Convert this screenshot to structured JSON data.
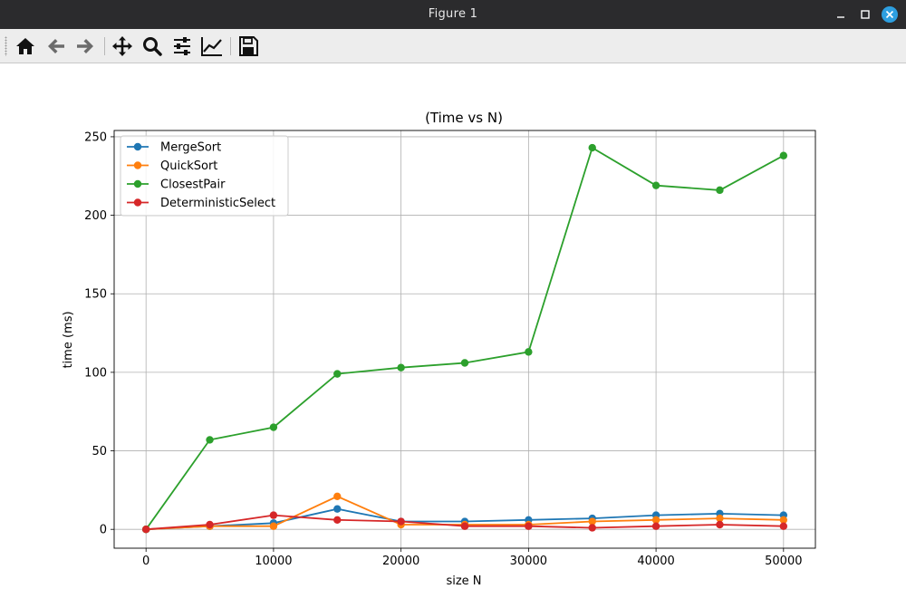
{
  "window": {
    "title": "Figure 1"
  },
  "toolbar": {
    "buttons": [
      {
        "name": "home-button",
        "icon": "home-icon"
      },
      {
        "name": "back-button",
        "icon": "arrow-left-icon"
      },
      {
        "name": "forward-button",
        "icon": "arrow-right-icon"
      },
      {
        "name": "pan-button",
        "icon": "move-icon"
      },
      {
        "name": "zoom-button",
        "icon": "magnifier-icon"
      },
      {
        "name": "configure-subplots-button",
        "icon": "sliders-icon"
      },
      {
        "name": "edit-axis-button",
        "icon": "line-chart-icon"
      },
      {
        "name": "save-button",
        "icon": "floppy-disk-icon"
      }
    ]
  },
  "colors": {
    "titlebar": "#2b2b2d",
    "close_button": "#2d9fe0",
    "grid": "#b0b0b0"
  },
  "chart_data": {
    "type": "line",
    "title": "(Time vs N)",
    "xlabel": "size N",
    "ylabel": "time (ms)",
    "xlim": [
      -2500,
      52500
    ],
    "ylim": [
      -12,
      254
    ],
    "grid": true,
    "legend_position": "top-left",
    "x": [
      0,
      5000,
      10000,
      15000,
      20000,
      25000,
      30000,
      35000,
      40000,
      45000,
      50000
    ],
    "xticks": [
      0,
      10000,
      20000,
      30000,
      40000,
      50000
    ],
    "yticks": [
      0,
      50,
      100,
      150,
      200,
      250
    ],
    "series": [
      {
        "name": "MergeSort",
        "color": "#1f77b4",
        "values": [
          0,
          2,
          4,
          13,
          5,
          5,
          6,
          7,
          9,
          10,
          9
        ]
      },
      {
        "name": "QuickSort",
        "color": "#ff7f0e",
        "values": [
          0,
          2,
          2,
          21,
          3,
          3,
          3,
          5,
          6,
          7,
          6
        ]
      },
      {
        "name": "ClosestPair",
        "color": "#2ca02c",
        "values": [
          0,
          57,
          65,
          99,
          103,
          106,
          113,
          243,
          219,
          216,
          238
        ]
      },
      {
        "name": "DeterministicSelect",
        "color": "#d62728",
        "values": [
          0,
          3,
          9,
          6,
          5,
          2,
          2,
          1,
          2,
          3,
          2
        ]
      }
    ]
  }
}
